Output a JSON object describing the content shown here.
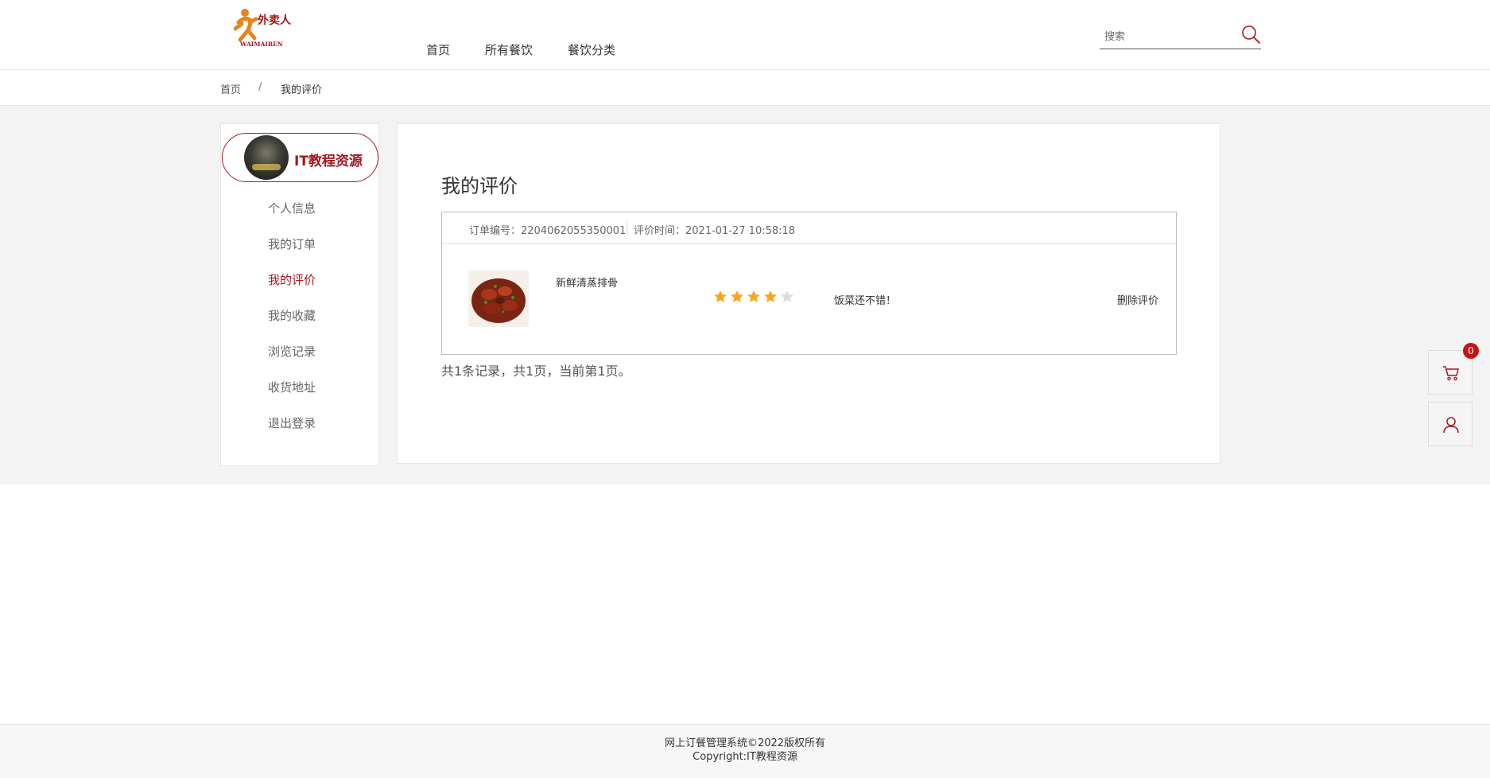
{
  "header": {
    "logo_text": "外卖人",
    "logo_subtext": "WAIMAIREN",
    "nav": [
      "首页",
      "所有餐饮",
      "餐饮分类"
    ],
    "search": {
      "placeholder": "搜索",
      "value": ""
    }
  },
  "breadcrumb": {
    "home": "首页",
    "separator": "/",
    "current": "我的评价"
  },
  "sidebar": {
    "user_name": "IT教程资源",
    "items": [
      {
        "label": "个人信息",
        "active": false
      },
      {
        "label": "我的订单",
        "active": false
      },
      {
        "label": "我的评价",
        "active": true
      },
      {
        "label": "我的收藏",
        "active": false
      },
      {
        "label": "浏览记录",
        "active": false
      },
      {
        "label": "收货地址",
        "active": false
      },
      {
        "label": "退出登录",
        "active": false
      }
    ]
  },
  "main": {
    "title": "我的评价",
    "reviews": [
      {
        "order_no": "订单编号：2204062055350001",
        "review_time": "评价时间：2021-01-27 10:58:18",
        "dish_name": "新鲜清蒸排骨",
        "rating": 4,
        "max_rating": 5,
        "text": "饭菜还不错！",
        "delete_label": "删除评价"
      }
    ],
    "summary": "共1条记录，共1页，当前第1页。"
  },
  "floating": {
    "cart_count": "0"
  },
  "footer": {
    "line1": "网上订餐管理系统©2022版权所有",
    "line2": "Copyright:IT教程资源"
  },
  "colors": {
    "accent": "#a8161e",
    "star_on": "#f5a623",
    "star_off": "#dddddd",
    "badge": "#c81313"
  }
}
